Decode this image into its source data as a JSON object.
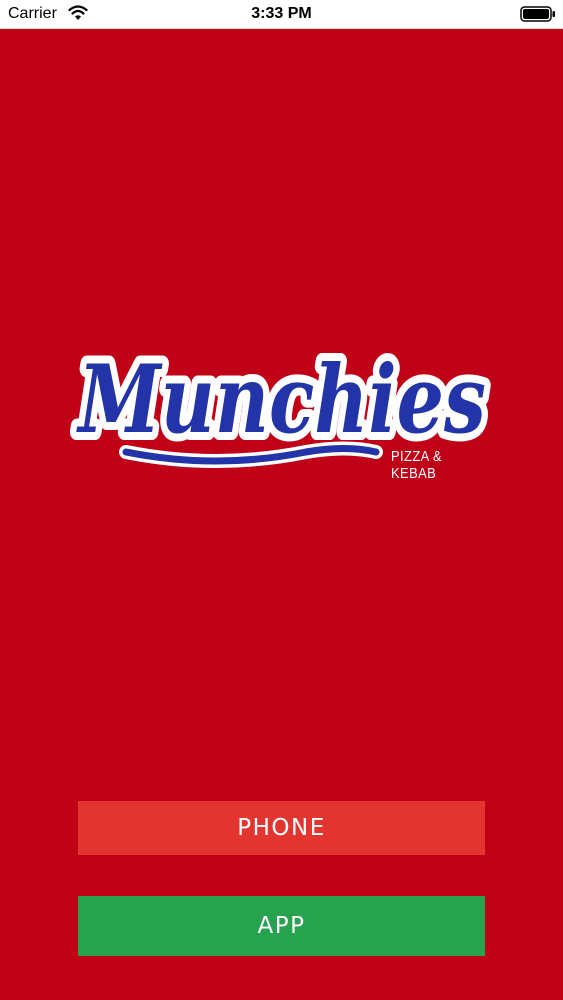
{
  "status_bar": {
    "carrier": "Carrier",
    "time": "3:33 PM",
    "wifi_icon": "wifi-icon",
    "battery_icon": "battery-icon"
  },
  "logo": {
    "name": "Munchies",
    "subtitle": "PIZZA & KEBAB",
    "text_color": "#2234a8",
    "outline_color": "#ffffff"
  },
  "buttons": {
    "phone_label": "PHONE",
    "app_label": "APP",
    "phone_color": "#e3352f",
    "app_color": "#27a24e"
  },
  "colors": {
    "background": "#c00016"
  }
}
